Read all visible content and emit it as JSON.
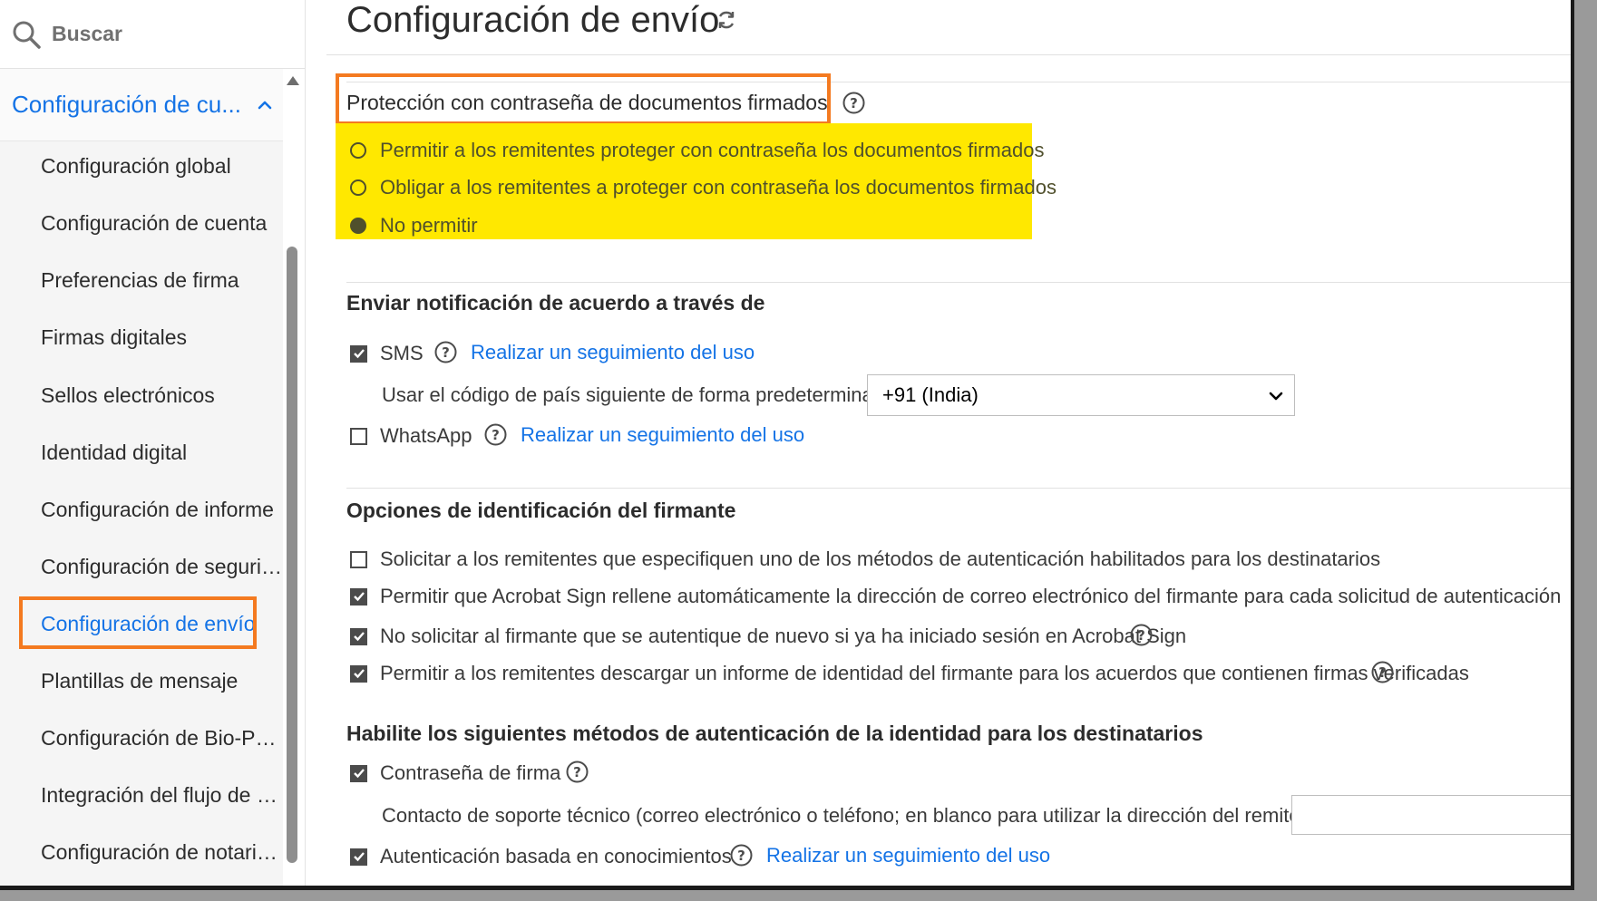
{
  "sidebar": {
    "search_placeholder": "Buscar",
    "section_title": "Configuración de cu...",
    "items": [
      {
        "label": "Configuración global"
      },
      {
        "label": "Configuración de cuenta"
      },
      {
        "label": "Preferencias de firma"
      },
      {
        "label": "Firmas digitales"
      },
      {
        "label": "Sellos electrónicos"
      },
      {
        "label": "Identidad digital"
      },
      {
        "label": "Configuración de informe"
      },
      {
        "label": "Configuración de seguridad"
      },
      {
        "label": "Configuración de envío",
        "active": true
      },
      {
        "label": "Plantillas de mensaje"
      },
      {
        "label": "Configuración de Bio-Pha..."
      },
      {
        "label": "Integración del flujo de tr..."
      },
      {
        "label": "Configuración de notariza..."
      }
    ]
  },
  "main": {
    "title": "Configuración de envío",
    "password_protection": {
      "heading": "Protección con contraseña de documentos firmados",
      "options": [
        {
          "label": "Permitir a los remitentes proteger con contraseña los documentos firmados",
          "selected": false
        },
        {
          "label": "Obligar a los remitentes a proteger con contraseña los documentos firmados",
          "selected": false
        },
        {
          "label": "No permitir",
          "selected": true
        }
      ]
    },
    "notification": {
      "heading": "Enviar notificación de acuerdo a través de",
      "sms_label": "SMS",
      "sms_checked": true,
      "sms_link": "Realizar un seguimiento del uso",
      "country_code_label": "Usar el código de país siguiente de forma predeterminada:",
      "country_code_value": "+91 (India)",
      "whatsapp_label": "WhatsApp",
      "whatsapp_checked": false,
      "whatsapp_link": "Realizar un seguimiento del uso"
    },
    "signer_identification": {
      "heading": "Opciones de identificación del firmante",
      "options": [
        {
          "label": "Solicitar a los remitentes que especifiquen uno de los métodos de autenticación habilitados para los destinatarios",
          "checked": false
        },
        {
          "label": "Permitir que Acrobat Sign rellene automáticamente la dirección de correo electrónico del firmante para cada solicitud de autenticación",
          "checked": true
        },
        {
          "label": "No solicitar al firmante que se autentique de nuevo si ya ha iniciado sesión en Acrobat Sign",
          "checked": true
        },
        {
          "label": "Permitir a los remitentes descargar un informe de identidad del firmante para los acuerdos que contienen firmas verificadas",
          "checked": true
        }
      ]
    },
    "auth_methods": {
      "heading": "Habilite los siguientes métodos de autenticación de la identidad para los destinatarios",
      "signing_password_label": "Contraseña de firma",
      "signing_password_checked": true,
      "support_contact_label": "Contacto de soporte técnico (correo electrónico o teléfono; en blanco para utilizar la dirección del remitente):",
      "kba_label": "Autenticación basada en conocimientos",
      "kba_checked": true,
      "kba_link": "Realizar un seguimiento del uso"
    }
  },
  "colors": {
    "accent": "#1473e6",
    "highlight_orange": "#f47a20",
    "highlight_yellow": "#ffe800"
  }
}
